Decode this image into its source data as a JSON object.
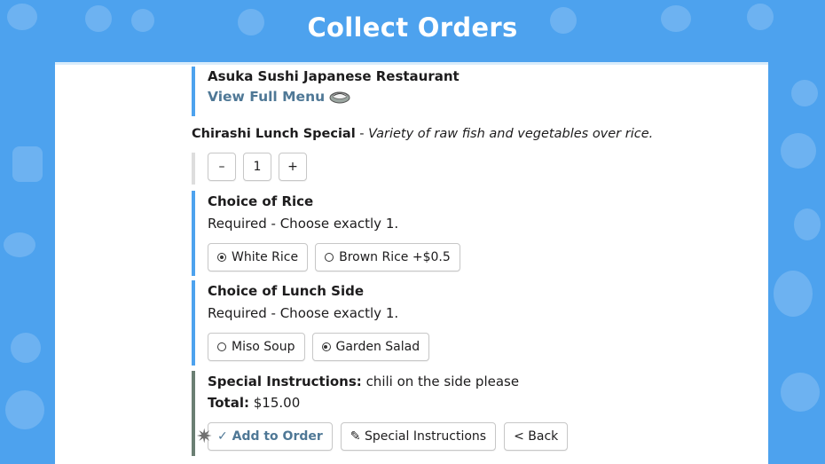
{
  "header": {
    "title": "Collect Orders"
  },
  "restaurant": {
    "name": "Asuka Sushi Japanese Restaurant",
    "view_menu_label": "View Full Menu"
  },
  "item": {
    "name": "Chirashi Lunch Special",
    "separator": " - ",
    "description": "Variety of raw fish and vegetables over rice."
  },
  "quantity": {
    "minus_label": "–",
    "value": "1",
    "plus_label": "+"
  },
  "rice": {
    "title": "Choice of Rice",
    "requirement": "Required - Choose exactly 1.",
    "options": [
      {
        "label": "White Rice",
        "selected": true
      },
      {
        "label": "Brown Rice +$0.5",
        "selected": false
      }
    ]
  },
  "side": {
    "title": "Choice of Lunch Side",
    "requirement": "Required - Choose exactly 1.",
    "options": [
      {
        "label": "Miso Soup",
        "selected": false
      },
      {
        "label": "Garden Salad",
        "selected": true
      }
    ]
  },
  "summary": {
    "instructions_label": "Special Instructions:",
    "instructions_value": " chili on the side please",
    "total_label": "Total:",
    "total_value": " $15.00"
  },
  "actions": {
    "add_label": "✓ Add to Order",
    "special_label": "✎ Special Instructions",
    "back_label": "< Back"
  },
  "colors": {
    "background": "#4da2ee",
    "link": "#4f7896",
    "accent_bar": "#4da2ee",
    "summary_bar": "#6b7f73"
  }
}
